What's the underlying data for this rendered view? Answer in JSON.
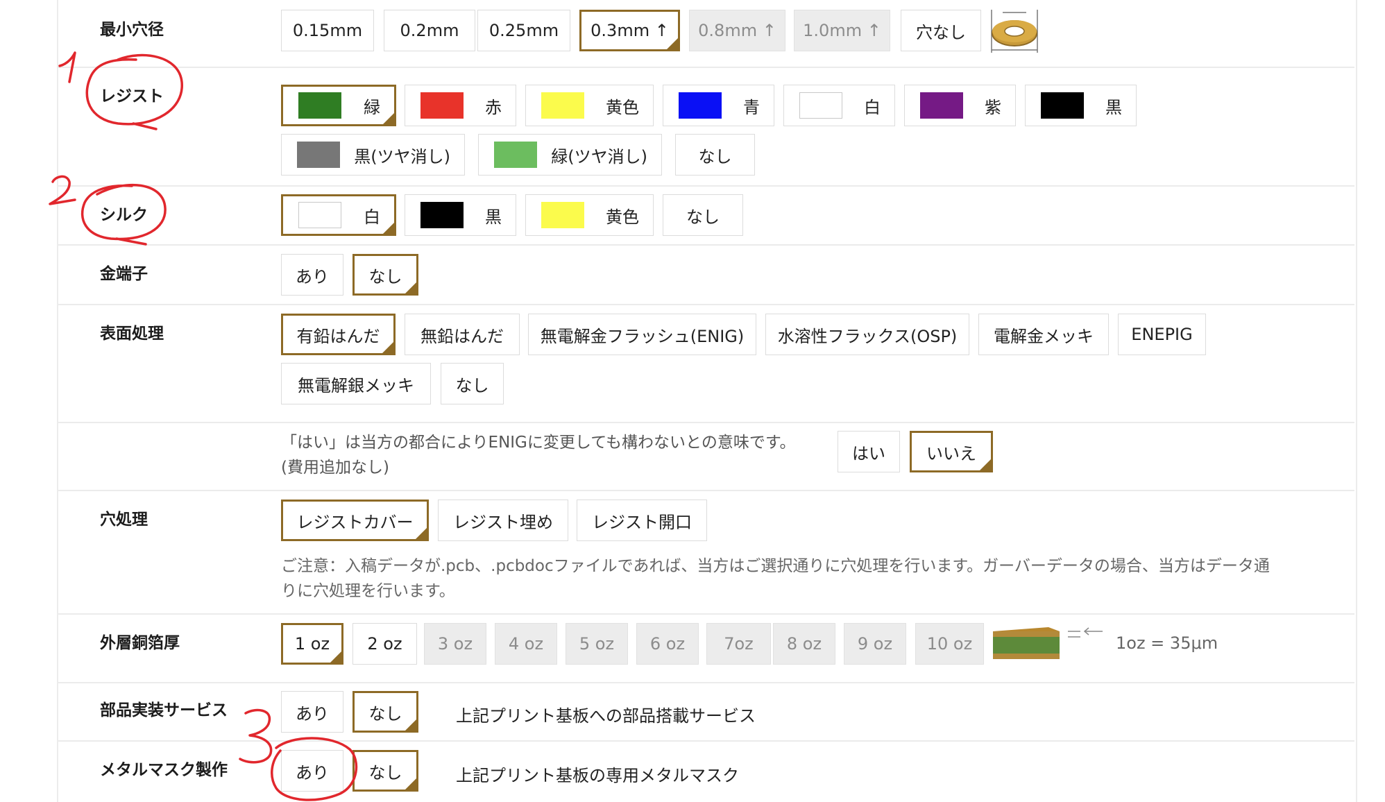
{
  "rows": {
    "hole": {
      "label": "最小穴径",
      "options": [
        "0.15mm",
        "0.2mm",
        "0.25mm",
        "0.3mm ↑",
        "0.8mm ↑",
        "1.0mm ↑",
        "穴なし"
      ],
      "selected": "0.3mm ↑",
      "disabled": [
        "0.8mm ↑",
        "1.0mm ↑"
      ],
      "icon": "via-hole-icon"
    },
    "resist": {
      "label": "レジスト",
      "options": [
        "緑",
        "赤",
        "黄色",
        "青",
        "白",
        "紫",
        "黒",
        "黒(ツヤ消し)",
        "緑(ツヤ消し)",
        "なし"
      ],
      "colors": [
        "#2f7d23",
        "#e8332a",
        "#fbfb4c",
        "#0a10f5",
        "#ffffff",
        "#751a85",
        "#000000",
        "#777777",
        "#6cbd5f",
        ""
      ],
      "selected": "緑"
    },
    "silk": {
      "label": "シルク",
      "options": [
        "白",
        "黒",
        "黄色",
        "なし"
      ],
      "colors": [
        "#ffffff",
        "#000000",
        "#fbfb4c",
        ""
      ],
      "selected": "白"
    },
    "gold": {
      "label": "金端子",
      "options": [
        "あり",
        "なし"
      ],
      "selected": "なし"
    },
    "surface": {
      "label": "表面処理",
      "options": [
        "有鉛はんだ",
        "無鉛はんだ",
        "無電解金フラッシュ(ENIG)",
        "水溶性フラックス(OSP)",
        "電解金メッキ",
        "ENEPIG",
        "無電解銀メッキ",
        "なし"
      ],
      "selected": "有鉛はんだ"
    },
    "enig": {
      "note_line1": "「はい」は当方の都合によりENIGに変更しても構わないとの意味です。",
      "note_line2": "(費用追加なし)",
      "options": [
        "はい",
        "いいえ"
      ],
      "selected": "いいえ"
    },
    "via": {
      "label": "穴処理",
      "options": [
        "レジストカバー",
        "レジスト埋め",
        "レジスト開口"
      ],
      "selected": "レジストカバー",
      "note_line1": "ご注意：入稿データが.pcb、.pcbdocファイルであれば、当方はご選択通りに穴処理を行います。ガーバーデータの場合、当方はデータ通",
      "note_line2": "りに穴処理を行います。"
    },
    "copper": {
      "label": "外層銅箔厚",
      "options": [
        "1 oz",
        "2 oz",
        "3 oz",
        "4 oz",
        "5 oz",
        "6 oz",
        "7oz",
        "8 oz",
        "9 oz",
        "10 oz"
      ],
      "selected": "1 oz",
      "disabled": [
        "3 oz",
        "4 oz",
        "5 oz",
        "6 oz",
        "7oz",
        "8 oz",
        "9 oz",
        "10 oz"
      ],
      "icon": "copper-layer-icon",
      "unit": "1oz = 35μm"
    },
    "assembly": {
      "label": "部品実装サービス",
      "options": [
        "あり",
        "なし"
      ],
      "selected": "なし",
      "desc": "上記プリント基板への部品搭載サービス"
    },
    "stencil": {
      "label": "メタルマスク製作",
      "options": [
        "あり",
        "なし"
      ],
      "selected": "なし",
      "desc": "上記プリント基板の専用メタルマスク"
    }
  },
  "annotations": {
    "marks": [
      "1",
      "2",
      "3"
    ],
    "color": "#e1272d"
  },
  "colors": {
    "accent": "#8d6a26",
    "border": "#dcdcdc",
    "disabled_bg": "#ececec"
  }
}
